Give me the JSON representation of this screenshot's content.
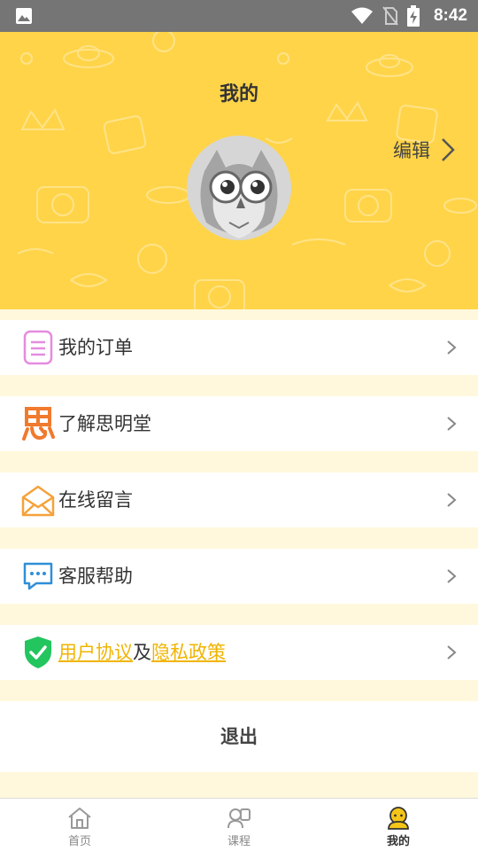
{
  "status_bar": {
    "time": "8:42"
  },
  "header": {
    "title": "我的",
    "edit_label": "编辑"
  },
  "menu": {
    "items": [
      {
        "label": "我的订单",
        "icon": "order-list-icon"
      },
      {
        "label": "了解思明堂",
        "icon": "si-logo-icon"
      },
      {
        "label": "在线留言",
        "icon": "envelope-icon"
      },
      {
        "label": "客服帮助",
        "icon": "chat-bubble-icon"
      }
    ],
    "agreement": {
      "user_agreement": "用户协议",
      "joiner": "及",
      "privacy_policy": "隐私政策",
      "icon": "shield-check-icon"
    }
  },
  "logout_label": "退出",
  "bottom_nav": {
    "items": [
      {
        "label": "首页",
        "icon": "home-icon"
      },
      {
        "label": "课程",
        "icon": "course-icon"
      },
      {
        "label": "我的",
        "icon": "profile-icon",
        "active": true
      }
    ]
  },
  "colors": {
    "header_bg": "#ffd449",
    "page_bg": "#fff8dc",
    "link": "#f0b400",
    "status_bar": "#757575"
  }
}
